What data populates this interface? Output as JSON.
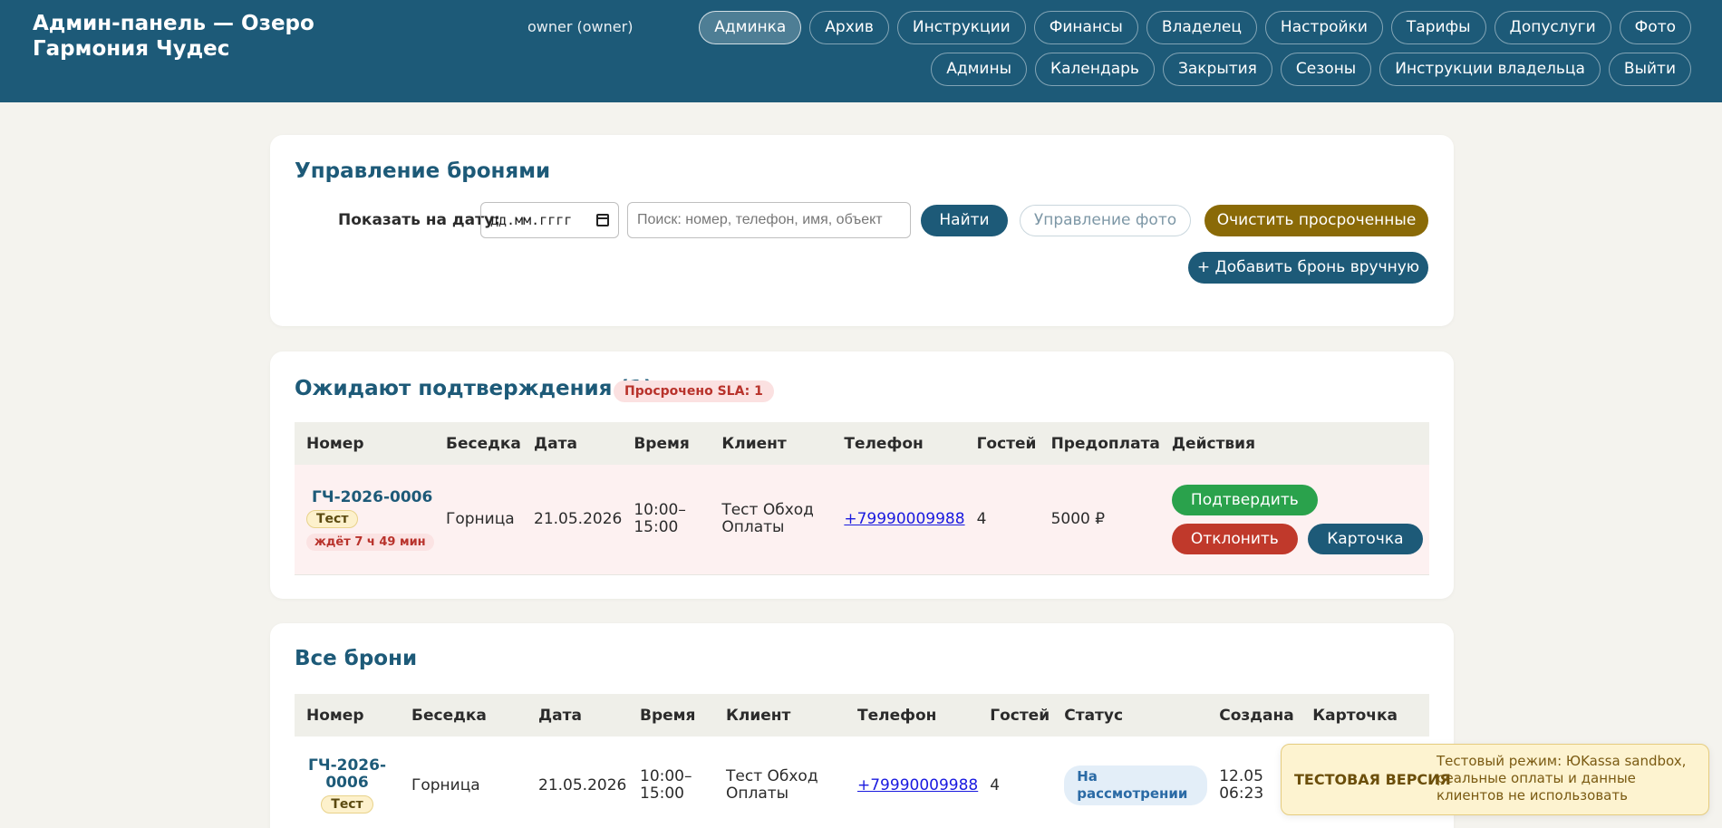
{
  "header": {
    "title": "Админ-панель — Озеро Гармония Чудес",
    "user": "owner (owner)",
    "nav": [
      {
        "label": "Админка",
        "active": true
      },
      {
        "label": "Архив"
      },
      {
        "label": "Инструкции"
      },
      {
        "label": "Финансы"
      },
      {
        "label": "Владелец"
      },
      {
        "label": "Настройки"
      },
      {
        "label": "Тарифы"
      },
      {
        "label": "Допуслуги"
      },
      {
        "label": "Фото"
      },
      {
        "label": "Админы"
      },
      {
        "label": "Календарь"
      },
      {
        "label": "Закрытия"
      },
      {
        "label": "Сезоны"
      },
      {
        "label": "Инструкции владельца"
      },
      {
        "label": "Выйти"
      }
    ]
  },
  "manage": {
    "title": "Управление бронями",
    "date_label": "Показать на дату:",
    "date_placeholder": "дд.мм.гггг",
    "search_placeholder": "Поиск: номер, телефон, имя, объект",
    "find_label": "Найти",
    "photo_label": "Управление фото",
    "clear_label": "Очистить просроченные",
    "add_label": "+ Добавить бронь вручную"
  },
  "pending": {
    "title": "Ожидают подтверждения (1)",
    "sla_badge": "Просрочено SLA: 1",
    "columns": [
      "Номер",
      "Беседка",
      "Дата",
      "Время",
      "Клиент",
      "Телефон",
      "Гостей",
      "Предоплата",
      "Действия"
    ],
    "row": {
      "number": "ГЧ-2026-0006",
      "tag": "Тест",
      "wait": "ждёт 7 ч 49 мин",
      "gazebo": "Горница",
      "date": "21.05.2026",
      "time": "10:00–\n15:00",
      "client": "Тест Обход Оплаты",
      "phone": "+79990009988",
      "guests": "4",
      "prepay": "5000 ₽",
      "confirm": "Подтвердить",
      "reject": "Отклонить",
      "card": "Карточка"
    }
  },
  "all": {
    "title": "Все брони",
    "columns": [
      "Номер",
      "Беседка",
      "Дата",
      "Время",
      "Клиент",
      "Телефон",
      "Гостей",
      "Статус",
      "Создана",
      "Карточка"
    ],
    "row": {
      "number": "ГЧ-2026-0006",
      "tag": "Тест",
      "gazebo": "Горница",
      "date": "21.05.2026",
      "time": "10:00–15:00",
      "client": "Тест Обход Оплаты",
      "phone": "+79990009988",
      "guests": "4",
      "status": "На рассмотрении",
      "created": "12.05 06:23"
    }
  },
  "toast": {
    "title": "ТЕСТОВАЯ ВЕРСИЯ",
    "text": "Тестовый режим: ЮKassa sandbox, реальные оплаты и данные клиентов не использовать"
  }
}
